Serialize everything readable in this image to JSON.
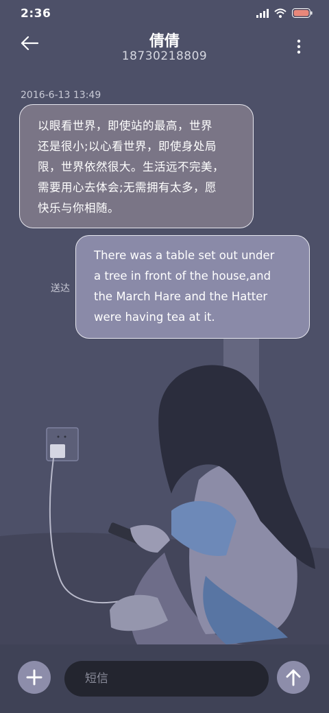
{
  "status_bar": {
    "time": "2:36",
    "icons": [
      "signal-icon",
      "wifi-icon",
      "battery-icon"
    ],
    "battery_color": "#e8877a"
  },
  "header": {
    "contact_name": "倩倩",
    "phone_number": "18730218809",
    "back_icon": "back-arrow-icon",
    "more_icon": "more-vertical-icon"
  },
  "conversation": {
    "timestamp": "2016-6-13 13:49",
    "messages": [
      {
        "direction": "incoming",
        "lines": [
          "以眼看世界，即使站的最高，世界",
          "还是很小;以心看世界，即使身处局",
          "限，世界依然很大。生活远不完美，",
          "需要用心去体会;无需拥有太多，愿",
          "快乐与你相随。"
        ]
      },
      {
        "direction": "outgoing",
        "status": "送达",
        "lines": [
          "There was a table set out under",
          "a tree in front of the house,and",
          "the March Hare and the Hatter",
          "were having tea at it."
        ]
      }
    ]
  },
  "composer": {
    "add_icon": "plus-icon",
    "placeholder": "短信",
    "value": "",
    "send_icon": "arrow-up-icon"
  },
  "colors": {
    "background": "#4d5068",
    "incoming_bubble": "#7a7586",
    "outgoing_bubble": "#8a8aa8",
    "input_background": "#23252f",
    "accent_button": "#8d8daa"
  }
}
